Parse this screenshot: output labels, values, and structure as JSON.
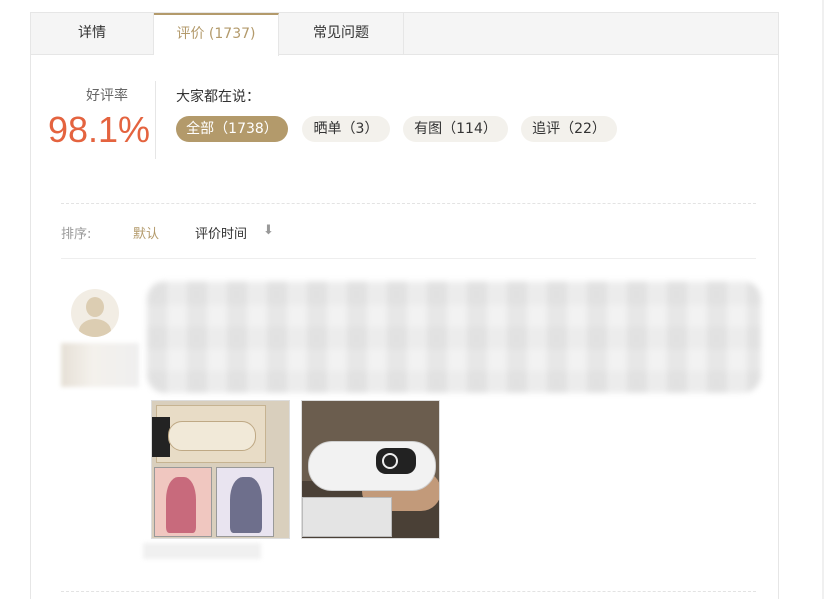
{
  "tabs": [
    {
      "label": "详情"
    },
    {
      "label": "评价 (1737)"
    },
    {
      "label": "常见问题"
    }
  ],
  "rating": {
    "label": "好评率",
    "value": "98.1%"
  },
  "tags": {
    "title": "大家都在说：",
    "items": [
      {
        "label": "全部（1738）"
      },
      {
        "label": "晒单（3）"
      },
      {
        "label": "有图（114）"
      },
      {
        "label": "追评（22）"
      }
    ]
  },
  "sort": {
    "label": "排序:",
    "default_label": "默认",
    "time_label": "评价时间",
    "arrow": "⬇"
  },
  "colors": {
    "accent": "#b39a6b",
    "rating": "#e4633f"
  },
  "icons": {
    "avatar": "user-avatar-placeholder",
    "sort": "arrow-down-icon"
  }
}
